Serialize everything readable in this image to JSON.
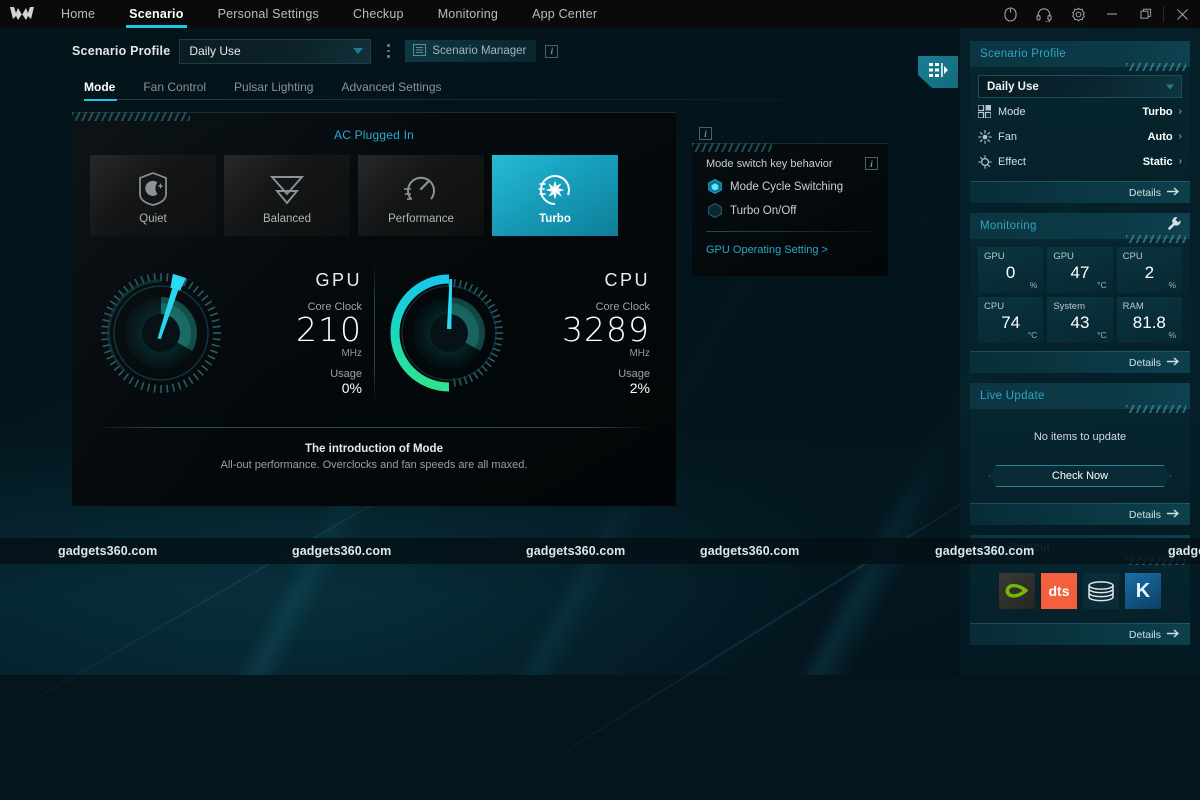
{
  "app": {
    "brand_icon": "predator-logo-icon",
    "nav": [
      {
        "label": "Home",
        "active": false
      },
      {
        "label": "Scenario",
        "active": true
      },
      {
        "label": "Personal Settings",
        "active": false
      },
      {
        "label": "Checkup",
        "active": false
      },
      {
        "label": "Monitoring",
        "active": false
      },
      {
        "label": "App Center",
        "active": false
      }
    ],
    "window_icons": [
      "mouse-icon",
      "headset-icon",
      "gear-icon",
      "minimize-icon",
      "restore-icon",
      "close-icon"
    ]
  },
  "profile_bar": {
    "label": "Scenario Profile",
    "selected": "Daily Use",
    "kebab_name": "more-options-icon",
    "manager_button": "Scenario Manager",
    "info_icon": "info-icon"
  },
  "tabs": [
    {
      "label": "Mode",
      "active": true
    },
    {
      "label": "Fan Control",
      "active": false
    },
    {
      "label": "Pulsar Lighting",
      "active": false
    },
    {
      "label": "Advanced Settings",
      "active": false
    }
  ],
  "power": {
    "status": "AC Plugged In",
    "info_icon": "info-icon"
  },
  "modes": [
    {
      "label": "Quiet",
      "icon": "moon-icon",
      "selected": false
    },
    {
      "label": "Balanced",
      "icon": "chevrons-down-icon",
      "selected": false
    },
    {
      "label": "Performance",
      "icon": "speedometer-icon",
      "selected": false
    },
    {
      "label": "Turbo",
      "icon": "turbine-icon",
      "selected": true
    }
  ],
  "gauges": [
    {
      "title": "GPU",
      "clock_label": "Core Clock",
      "clock_value": "210",
      "clock_unit": "MHz",
      "usage_label": "Usage",
      "usage_value": "0%",
      "arc_fraction": 0.04,
      "needle_angle_deg": 198
    },
    {
      "title": "CPU",
      "clock_label": "Core Clock",
      "clock_value": "3289",
      "clock_unit": "MHz",
      "usage_label": "Usage",
      "usage_value": "2%",
      "arc_fraction": 0.52,
      "needle_angle_deg": 2
    }
  ],
  "intro": {
    "title": "The introduction of Mode",
    "description": "All-out performance. Overclocks and fan speeds are all maxed."
  },
  "mode_switch": {
    "title": "Mode switch key behavior",
    "info_icon": "info-icon",
    "options": [
      {
        "label": "Mode Cycle Switching",
        "selected": true
      },
      {
        "label": "Turbo On/Off",
        "selected": false
      }
    ],
    "link": "GPU Operating Setting >"
  },
  "sidebar_toggle": {
    "icon": "panel-collapse-icon"
  },
  "sidebar": {
    "scenario_profile": {
      "title": "Scenario Profile",
      "selected": "Daily Use",
      "rows": [
        {
          "icon": "grid-squares-icon",
          "key": "Mode",
          "value": "Turbo",
          "arrow": "›"
        },
        {
          "icon": "fan-sun-icon",
          "key": "Fan",
          "value": "Auto",
          "arrow": "›"
        },
        {
          "icon": "effect-bulb-icon",
          "key": "Effect",
          "value": "Static",
          "arrow": "›"
        }
      ],
      "details": "Details"
    },
    "monitoring": {
      "title": "Monitoring",
      "wrench_icon": "wrench-icon",
      "tiles": [
        {
          "key": "GPU",
          "value": "0",
          "unit": "%"
        },
        {
          "key": "GPU",
          "value": "47",
          "unit": "°C"
        },
        {
          "key": "CPU",
          "value": "2",
          "unit": "%"
        },
        {
          "key": "CPU",
          "value": "74",
          "unit": "°C"
        },
        {
          "key": "System",
          "value": "43",
          "unit": "°C"
        },
        {
          "key": "RAM",
          "value": "81.8",
          "unit": "%"
        }
      ],
      "details": "Details"
    },
    "live_update": {
      "title": "Live Update",
      "message": "No items to update",
      "button": "Check Now",
      "details": "Details"
    },
    "app_shortcut": {
      "title": "App Shortcut",
      "apps": [
        {
          "name": "nvidia-icon",
          "label": "NVIDIA"
        },
        {
          "name": "dts-icon",
          "label": "dts"
        },
        {
          "name": "disc-icon",
          "label": "Disc"
        },
        {
          "name": "killer-network-icon",
          "label": "K"
        }
      ],
      "details": "Details"
    }
  },
  "watermark": {
    "text": "gadgets360.com",
    "positions": [
      58,
      292,
      526,
      700,
      935,
      1168
    ]
  },
  "colors": {
    "accent_cyan": "#18c8e8",
    "teal": "#2ea6c4",
    "turbo_card": "#17a0bd",
    "green": "#2ee08a"
  }
}
